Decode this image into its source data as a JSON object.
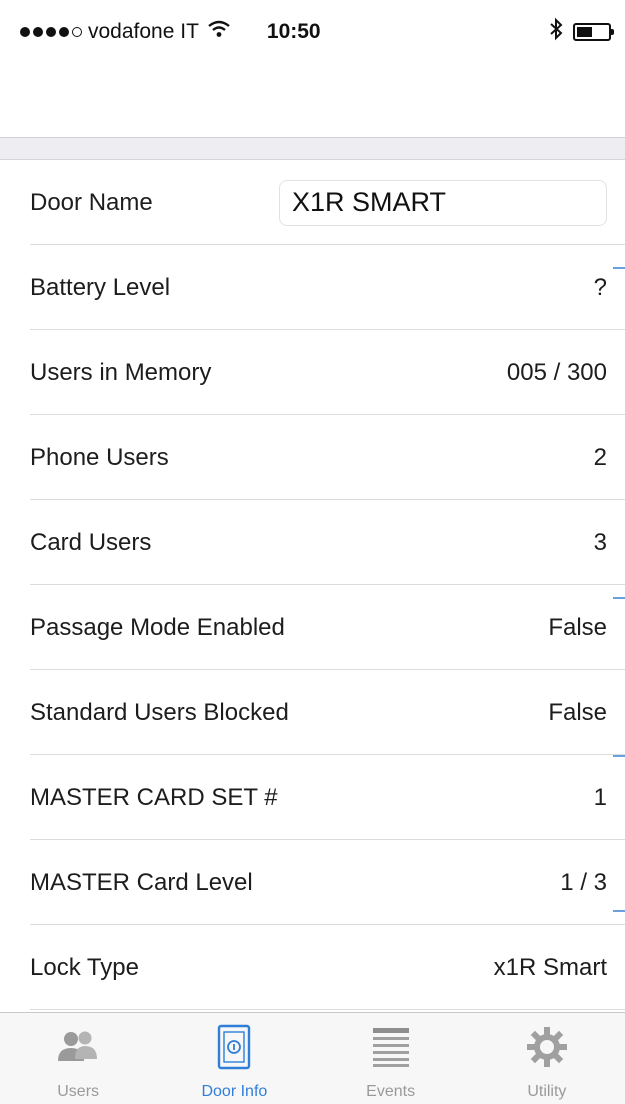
{
  "status_bar": {
    "carrier": "vodafone IT",
    "time": "10:50",
    "signal_bars_filled": 4,
    "signal_bars_total": 5
  },
  "door": {
    "name_label": "Door Name",
    "name_value": "X1R SMART"
  },
  "info_rows": [
    {
      "label": "Battery Level",
      "value": "?"
    },
    {
      "label": "Users in Memory",
      "value": "005 / 300"
    },
    {
      "label": "Phone Users",
      "value": "2"
    },
    {
      "label": "Card Users",
      "value": "3"
    },
    {
      "label": "Passage Mode Enabled",
      "value": "False"
    },
    {
      "label": "Standard Users Blocked",
      "value": "False"
    },
    {
      "label": "MASTER CARD SET #",
      "value": "1"
    },
    {
      "label": "MASTER Card Level",
      "value": "1 / 3"
    },
    {
      "label": "Lock Type",
      "value": "x1R Smart"
    }
  ],
  "tabs": [
    {
      "label": "Users",
      "icon": "users-icon"
    },
    {
      "label": "Door Info",
      "icon": "door-info-icon"
    },
    {
      "label": "Events",
      "icon": "events-list-icon"
    },
    {
      "label": "Utility",
      "icon": "gear-icon"
    }
  ],
  "active_tab": "Door Info",
  "colors": {
    "accent": "#2f7fd8",
    "inactive_tab": "#9a9a9a",
    "separator": "#dcdcdf",
    "section_background": "#eeeef2"
  }
}
